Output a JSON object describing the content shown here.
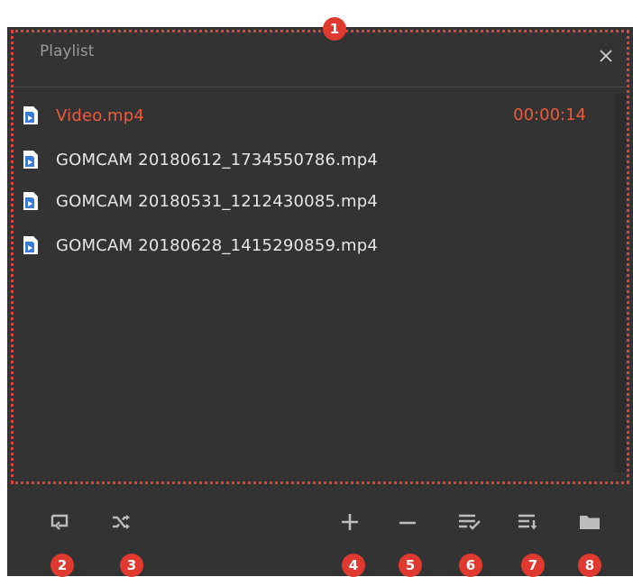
{
  "playlist": {
    "title": "Playlist",
    "items": [
      {
        "name": "Video.mp4",
        "duration": "00:00:14",
        "active": true
      },
      {
        "name": "GOMCAM  20180612_1734550786.mp4",
        "duration": "",
        "active": false
      },
      {
        "name": "GOMCAM  20180531_1212430085.mp4",
        "duration": "",
        "active": false
      },
      {
        "name": "GOMCAM  20180628_1415290859.mp4",
        "duration": "",
        "active": false
      }
    ]
  },
  "toolbar": {
    "buttons": [
      {
        "icon": "repeat-icon"
      },
      {
        "icon": "shuffle-icon"
      },
      {
        "icon": "add-icon"
      },
      {
        "icon": "remove-icon"
      },
      {
        "icon": "select-all-icon"
      },
      {
        "icon": "sort-icon"
      },
      {
        "icon": "folder-icon"
      }
    ]
  },
  "badges": [
    "1",
    "2",
    "3",
    "4",
    "5",
    "6",
    "7",
    "8"
  ],
  "colors": {
    "panel_bg": "#333333",
    "accent": "#ef5a3c",
    "badge": "#e03a30",
    "text": "#e6e6e6",
    "icon": "#bdbdbd",
    "file_icon": "#3a7bd5"
  }
}
